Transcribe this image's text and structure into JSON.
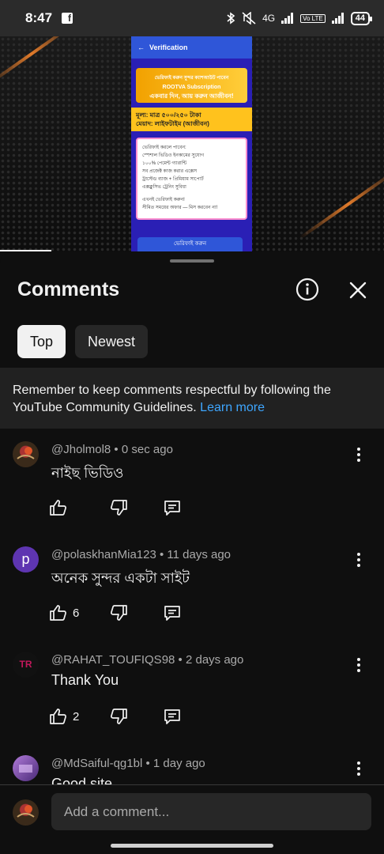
{
  "status_bar": {
    "time": "8:47",
    "battery": "44",
    "signal_label_1": "4G",
    "signal_label_2": "Vo LTE"
  },
  "video": {
    "phone_header": "Verification",
    "card1_line1": "ভেরিফাই করুন সুন্দর ক্যাশআউট পাবেন",
    "card1_line2": "ROOTVA Subscription",
    "card1_line3": "একবার দিন, আয় করুন আজীবন!",
    "card2_line1": "মূল্য: মাত্র ৫০০/২৫০ টাকা",
    "card2_line2": "মেয়াদ: লাইফটাইম (আজীবন)",
    "card3_lines": [
      "ভেরিফাই করলে পাবেন:",
      "স্পেশাল ভিডিও ইনকামের সুযোগ",
      "১০০% পেমেন্ট গ্যারান্টি",
      "সব প্রজেক্ট কাজ করার এক্সেস",
      "ট্রাস্টেড ব্যাজ + প্রিমিয়াম সাপোর্ট",
      "এক্সক্লুসিভ ট্রেনিং সুবিধা",
      "এখনই ভেরিফাই করুন!",
      "সীমিত সময়ের অফার — মিস করবেন না!"
    ],
    "button": "ভেরিফাই করুন"
  },
  "sheet": {
    "title": "Comments",
    "tabs": [
      {
        "label": "Top",
        "active": true
      },
      {
        "label": "Newest",
        "active": false
      }
    ],
    "notice_text": "Remember to keep comments respectful by following the YouTube Community Guidelines. ",
    "notice_link": "Learn more"
  },
  "comments": [
    {
      "author": "@Jholmol8",
      "time": "0 sec ago",
      "text": "নাইছ ভিডিও",
      "likes": "",
      "avatar_letter": "",
      "avatar_color": "#3a2a1a"
    },
    {
      "author": "@polaskhanMia123",
      "time": "11 days ago",
      "text": "অনেক সুন্দর একটা সাইট",
      "likes": "6",
      "avatar_letter": "p",
      "avatar_color": "#5e35b1"
    },
    {
      "author": "@RAHAT_TOUFIQS98",
      "time": "2 days ago",
      "text": "Thank You",
      "likes": "2",
      "avatar_letter": "",
      "avatar_color": "#111111"
    },
    {
      "author": "@MdSaiful-qg1bl",
      "time": "1 day ago",
      "text": "Good site",
      "likes": "",
      "avatar_letter": "",
      "avatar_color": "#7b4fa8"
    }
  ],
  "input": {
    "placeholder": "Add a comment..."
  },
  "colors": {
    "background": "#0f0f0f",
    "link": "#3ea6ff",
    "notice_bg": "#212121"
  }
}
